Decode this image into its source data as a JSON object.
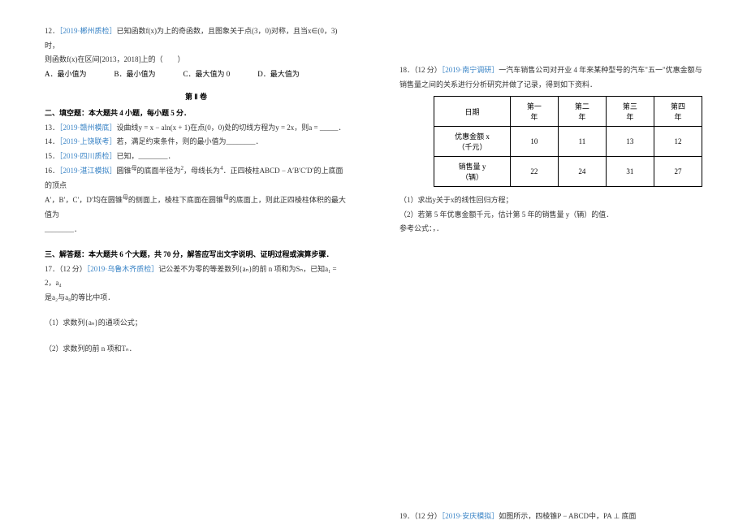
{
  "left": {
    "q12": {
      "l1": "12．",
      "ref": "［2019·郴州质检］",
      "l1b": "已知函数f(x)为上的奇函数，且图象关于点(3，0)对称，且当x∈(0，3)时，",
      "l2": "则函数f(x)在区间[2013，2018]上的（　　）",
      "opts": {
        "a": "A．最小值为",
        "b": "B．最小值为",
        "c": "C．最大值为 0",
        "d": "D．最大值为"
      }
    },
    "section2": "第 Ⅱ 卷",
    "heading_fill": "二、填空题：本大题共 4 小题，每小题 5 分．",
    "q13": {
      "p": "13．",
      "ref": "［2019·赣州模底］",
      "t": "设曲线y = x − aln(x + 1)在点(0，0)处的切线方程为y = 2x，则a = _____．"
    },
    "q14": {
      "p": "14．",
      "ref": "［2019·上饶联考］",
      "t": "若，满足约束条件，则的最小值为________．"
    },
    "q15": {
      "p": "15．",
      "ref": "［2019·四川质检］",
      "t": "已知，________．"
    },
    "q16": {
      "p": "16．",
      "ref": "［2019·湛江模拟］",
      "t1": "圆锥",
      "t1b": "母",
      "t1c": "的底面半径为",
      "t1d": "2",
      "t1e": "，母线长为",
      "t1f": "4",
      "t1g": "．正四棱柱ABCD − A′B′C′D′的上底面的顶点",
      "t2": "A′，B′，C′，D′均在圆锥",
      "t2b": "母",
      "t2c": "的侧面上，棱柱下底面在圆锥",
      "t2d": "母",
      "t2e": "的底面上，则此正四棱柱体积的最大值为",
      "t3": "________．"
    },
    "heading_solve": "三、解答题：本大题共 6 个大题，共 70 分，解答应写出文字说明、证明过程或演算步骤．",
    "q17": {
      "p": "17．（12 分）",
      "ref": "［2019·乌鲁木齐质检］",
      "t1": "记公差不为零的等差数列{aₙ}的前 n 项和为Sₙ，已知a₁ = 2，a₄",
      "t2": "是a₂与a₈的等比中项．",
      "sub1": "（1）求数列{aₙ}的通项公式；",
      "sub2": "（2）求数列的前 n 项和Tₙ．"
    }
  },
  "right": {
    "q18": {
      "p": "18．（12 分）",
      "ref": "［2019·南宁调研］",
      "t1": "一汽车销售公司对开业 4 年来某种型号的汽车\"五一\"优惠金额与",
      "t2": "销售量之间的关系进行分析研究并做了记录，得到如下资料．",
      "table": {
        "headers": [
          "日期",
          "第一年",
          "第二年",
          "第三年",
          "第四年"
        ],
        "row1": [
          "优惠金额 x（千元）",
          "10",
          "11",
          "13",
          "12"
        ],
        "row2": [
          "销售量 y（辆）",
          "22",
          "24",
          "31",
          "27"
        ]
      },
      "sub1": "（1）求出y关于x的线性回归方程；",
      "sub2": "（2）若第 5 年优惠金额千元，估计第 5 年的销售量 y（辆）的值．",
      "note": "参考公式：，．"
    },
    "q19": {
      "p": "19．（12 分）",
      "ref": "［2019·安庆模拟］",
      "t": "如图所示，四棱锥P − ABCD中，PA ⊥ 底面"
    }
  }
}
